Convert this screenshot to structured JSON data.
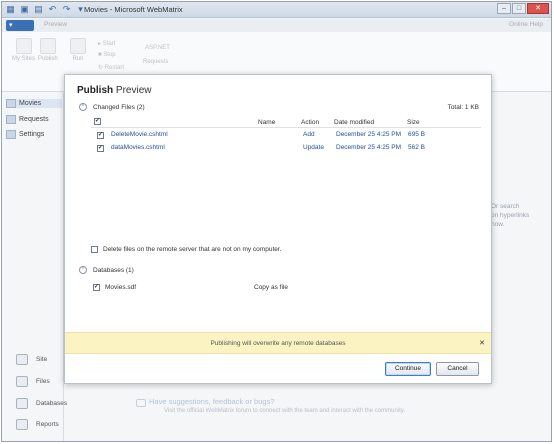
{
  "window": {
    "title": "Movies - Microsoft WebMatrix"
  },
  "ribbon": {
    "tab_preview": "Preview",
    "help": "Online Help",
    "buttons": [
      "My Sites",
      "Publish",
      "Run"
    ],
    "small_buttons": [
      "Start",
      "Stop",
      "Restart"
    ],
    "requests_label": "Requests",
    "asp_label": "ASP.NET"
  },
  "sidebar": {
    "items": [
      "Movies",
      "Requests",
      "Settings"
    ],
    "nav": [
      "Site",
      "Files",
      "Databases",
      "Reports"
    ]
  },
  "hints": {
    "right": [
      "Or search",
      "on hyperlinks",
      "now."
    ],
    "feedback_title": "Have suggestions, feedback or bugs?",
    "feedback_body": "Visit the official WebMatrix forum to connect with the team and interact with the community."
  },
  "dialog": {
    "title_bold": "Publish",
    "title_sub": "Preview",
    "changed_files_label": "Changed Files (2)",
    "total": "Total: 1 KB",
    "columns": {
      "name": "Name",
      "action": "Action",
      "date": "Date modified",
      "size": "Size"
    },
    "files": [
      {
        "name": "DeleteMovie.cshtml",
        "action": "Add",
        "date": "December 25 4:25 PM",
        "size": "695 B"
      },
      {
        "name": "dataMovies.cshtml",
        "action": "Update",
        "date": "December 25 4:25 PM",
        "size": "562 B"
      }
    ],
    "delete_option": "Delete files on the remote server that are not on my computer.",
    "databases_label": "Databases (1)",
    "database": {
      "name": "Movies.sdf",
      "method": "Copy as file"
    },
    "warning": "Publishing will overwrite any remote databases",
    "continue_label": "Continue",
    "cancel_label": "Cancel"
  }
}
